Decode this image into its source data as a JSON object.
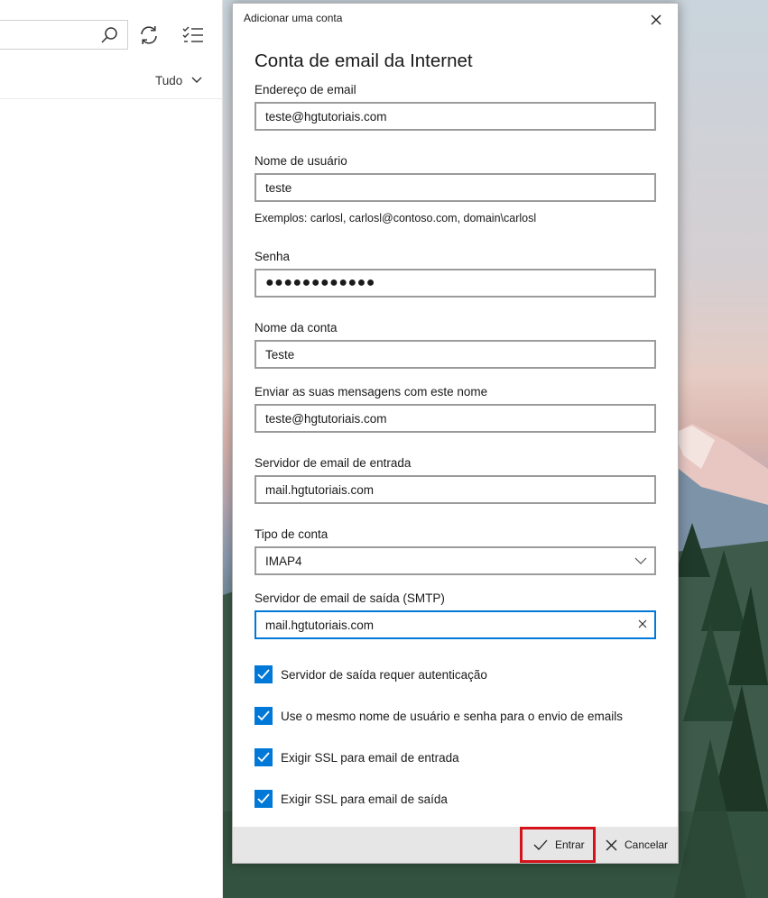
{
  "app_pane": {
    "filter_label": "Tudo",
    "icons": [
      "search-icon",
      "sync-icon",
      "filter-select-icon",
      "chevron-down-icon"
    ]
  },
  "dialog": {
    "title": "Adicionar uma conta",
    "heading": "Conta de email da Internet",
    "fields": {
      "email": {
        "label": "Endereço de email",
        "value": "teste@hgtutoriais.com"
      },
      "username": {
        "label": "Nome de usuário",
        "value": "teste",
        "hint": "Exemplos: carlosl, carlosl@contoso.com, domain\\carlosl"
      },
      "password": {
        "label": "Senha",
        "value": "●●●●●●●●●●●●"
      },
      "account_name": {
        "label": "Nome da conta",
        "value": "Teste"
      },
      "send_name": {
        "label": "Enviar as suas mensagens com este nome",
        "value": "teste@hgtutoriais.com"
      },
      "incoming_server": {
        "label": "Servidor de email de entrada",
        "value": "mail.hgtutoriais.com"
      },
      "account_type": {
        "label": "Tipo de conta",
        "value": "IMAP4"
      },
      "outgoing_server": {
        "label": "Servidor de email de saída (SMTP)",
        "value": "mail.hgtutoriais.com"
      }
    },
    "checkboxes": [
      {
        "label": "Servidor de saída requer autenticação",
        "checked": true
      },
      {
        "label": "Use o mesmo nome de usuário e senha para o envio de emails",
        "checked": true
      },
      {
        "label": "Exigir SSL para email de entrada",
        "checked": true
      },
      {
        "label": "Exigir SSL para email de saída",
        "checked": true
      }
    ],
    "buttons": {
      "enter": "Entrar",
      "cancel": "Cancelar"
    }
  },
  "colors": {
    "accent": "#0078d7",
    "highlight": "#d6131b",
    "footer": "#e6e6e6"
  }
}
